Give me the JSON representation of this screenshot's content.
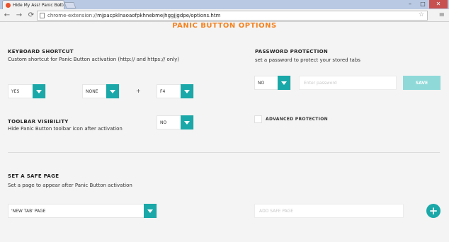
{
  "browser": {
    "tab_title": "Hide My Ass! Panic Button",
    "url_scheme": "chrome-extension://",
    "url_rest": "mjpacpklnaoaofpkhnebmejhggjjgdpe/options.htm",
    "close_glyph": "×",
    "min_glyph": "–",
    "max_glyph": "□",
    "winclose_glyph": "✕",
    "back_glyph": "←",
    "forward_glyph": "→",
    "reload_glyph": "⟳",
    "star_glyph": "☆",
    "menu_glyph": "≡"
  },
  "page": {
    "title": "PANIC BUTTON OPTIONS",
    "keyboard": {
      "heading": "KEYBOARD SHORTCUT",
      "description": "Custom shortcut for Panic Button activation (http:// and https:// only)",
      "enabled_value": "YES",
      "modifier_value": "NONE",
      "plus": "+",
      "key_value": "F4"
    },
    "toolbar_visibility": {
      "heading": "TOOLBAR VISIBILITY",
      "description": "Hide Panic Button toolbar icon after activation",
      "value": "NO"
    },
    "password": {
      "heading": "PASSWORD PROTECTION",
      "description": "set a password to protect your stored tabs",
      "value": "NO",
      "placeholder": "Enter password",
      "save_label": "SAVE"
    },
    "advanced": {
      "label": "ADVANCED PROTECTION"
    },
    "safe_page": {
      "heading": "SET A SAFE PAGE",
      "description": "Set a page to appear after Panic Button activation",
      "value": "'NEW TAB' PAGE",
      "placeholder": "ADD SAFE PAGE",
      "add_glyph": "+"
    }
  },
  "colors": {
    "accent_teal": "#1aa8a8",
    "title_orange": "#f5821f",
    "save_disabled": "#8fd9d9"
  }
}
